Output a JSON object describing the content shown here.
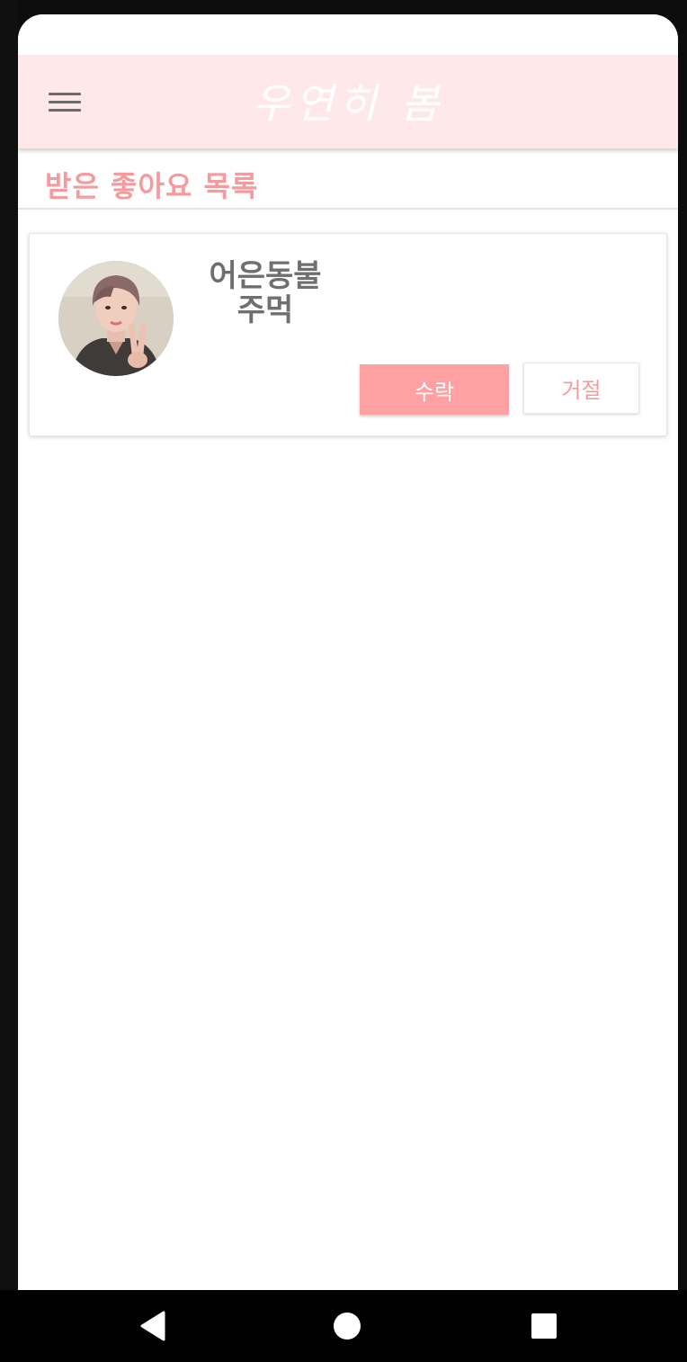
{
  "app_bar": {
    "title": "우연히 봄",
    "menu_icon": "hamburger-menu-icon"
  },
  "section": {
    "title": "받은 좋아요 목록"
  },
  "likes": [
    {
      "name_line1": "어은동불",
      "name_line2": "주먹",
      "accept_label": "수락",
      "reject_label": "거절"
    }
  ],
  "nav": {
    "back_icon": "back-triangle-icon",
    "home_icon": "home-circle-icon",
    "recents_icon": "recents-square-icon"
  },
  "colors": {
    "app_bar_bg": "#ffe8ea",
    "accent": "#f79a9d",
    "accept_bg": "#ffa0a3",
    "name_text": "#6f6f6f"
  }
}
